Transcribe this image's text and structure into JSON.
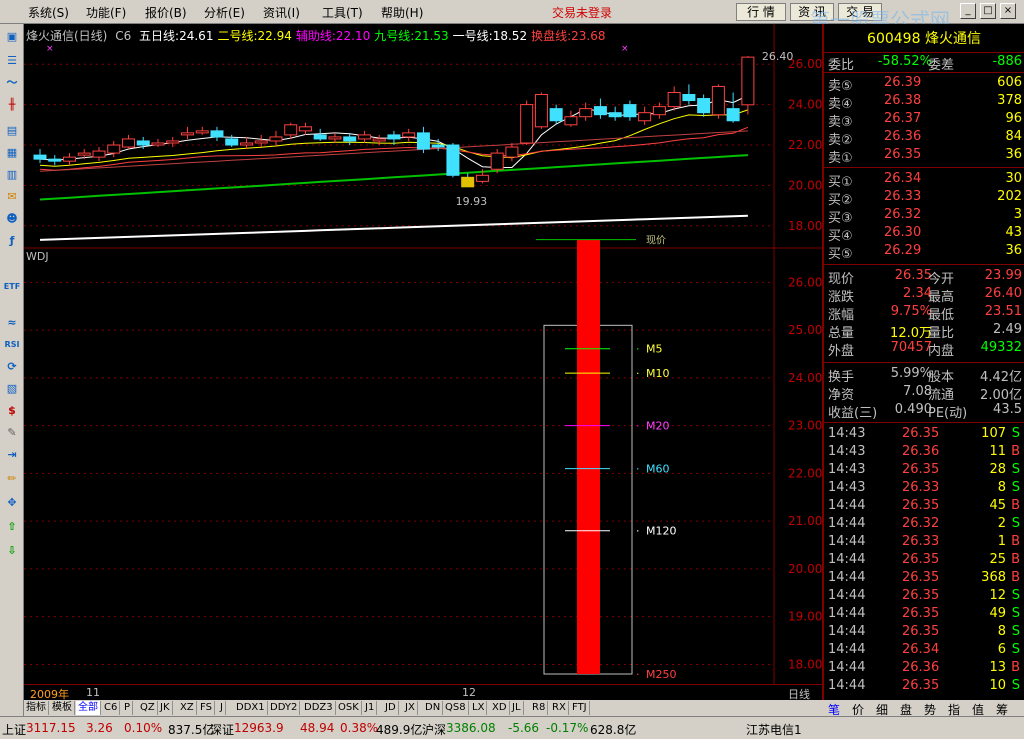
{
  "menu": {
    "items": [
      "系统(S)",
      "功能(F)",
      "报价(B)",
      "分析(E)",
      "资讯(I)",
      "工具(T)",
      "帮助(H)"
    ],
    "login_status": "交易未登录",
    "quote_button": "行 情",
    "info_button": "资 讯",
    "trade_button": "交 易"
  },
  "watermark": "第一股票公式网",
  "chart": {
    "title": "烽火通信(日线)",
    "indicator": "C6",
    "lines": [
      {
        "label": "五日线:",
        "value": "24.61",
        "color": "#ffffff"
      },
      {
        "label": "二号线:",
        "value": "22.94",
        "color": "#ffff00"
      },
      {
        "label": "辅助线:",
        "value": "22.10",
        "color": "#ff00ff"
      },
      {
        "label": "九号线:",
        "value": "21.53",
        "color": "#00ff00"
      },
      {
        "label": "一号线:",
        "value": "18.52",
        "color": "#ffffff"
      },
      {
        "label": "换盘线:",
        "value": "23.68",
        "color": "#ff4040"
      }
    ],
    "high_marker": "26.40",
    "low_marker": "19.93",
    "upper_axis": [
      "26.00",
      "24.00",
      "22.00",
      "20.00",
      "18.00"
    ],
    "lower_title": "WDJ",
    "lower_axis": [
      "26.00",
      "25.00",
      "24.00",
      "23.00",
      "22.00",
      "21.00",
      "20.00",
      "19.00",
      "18.00"
    ],
    "ma_labels": [
      "M5",
      "M10",
      "M20",
      "M60",
      "M120",
      "M250"
    ],
    "top_label": "现价",
    "dates": {
      "year": "2009年",
      "m1": "11",
      "m2": "12",
      "period": "日线"
    }
  },
  "bottom_tabs": [
    "指标",
    "模板",
    "全部",
    "C6",
    "P",
    "QZ",
    "JK",
    "XZ",
    "FS",
    "J",
    "DDX1",
    "DDY2",
    "DDZ3",
    "OSK",
    "J1",
    "JD",
    "JX",
    "DN",
    "QS8",
    "LX",
    "XD",
    "JL",
    "R8",
    "RX",
    "FTJ"
  ],
  "status": {
    "sh_label": "上证",
    "sh_val": "3117.15",
    "sh_chg": "3.26",
    "sh_pct": "0.10%",
    "sh_amt": "837.5亿",
    "sz_label": "深证",
    "sz_val": "12963.9",
    "sz_chg": "48.94",
    "sz_pct": "0.38%",
    "sz_amt": "489.9亿",
    "hs_label": "沪深",
    "hs_val": "3386.08",
    "hs_chg": "-5.66",
    "hs_pct": "-0.17%",
    "hs_amt": "628.8亿",
    "isp": "江苏电信1"
  },
  "quote": {
    "code_name": "600498 烽火通信",
    "ratio_label": "委比",
    "ratio": "-58.52%",
    "diff_label": "委差",
    "diff": "-886",
    "sells": [
      {
        "label": "卖⑤",
        "price": "26.39",
        "vol": "606"
      },
      {
        "label": "卖④",
        "price": "26.38",
        "vol": "378"
      },
      {
        "label": "卖③",
        "price": "26.37",
        "vol": "96"
      },
      {
        "label": "卖②",
        "price": "26.36",
        "vol": "84"
      },
      {
        "label": "卖①",
        "price": "26.35",
        "vol": "36"
      }
    ],
    "buys": [
      {
        "label": "买①",
        "price": "26.34",
        "vol": "30"
      },
      {
        "label": "买②",
        "price": "26.33",
        "vol": "202"
      },
      {
        "label": "买③",
        "price": "26.32",
        "vol": "3"
      },
      {
        "label": "买④",
        "price": "26.30",
        "vol": "43"
      },
      {
        "label": "买⑤",
        "price": "26.29",
        "vol": "36"
      }
    ],
    "stats": [
      {
        "l1": "现价",
        "v1": "26.35",
        "c1": "#ff4040",
        "l2": "今开",
        "v2": "23.99",
        "c2": "#ff4040"
      },
      {
        "l1": "涨跌",
        "v1": "2.34",
        "c1": "#ff4040",
        "l2": "最高",
        "v2": "26.40",
        "c2": "#ff4040"
      },
      {
        "l1": "涨幅",
        "v1": "9.75%",
        "c1": "#ff4040",
        "l2": "最低",
        "v2": "23.51",
        "c2": "#ff4040"
      },
      {
        "l1": "总量",
        "v1": "12.0万",
        "c1": "#ffff00",
        "l2": "量比",
        "v2": "2.49",
        "c2": "#c0c0c0"
      },
      {
        "l1": "外盘",
        "v1": "70457",
        "c1": "#ff4040",
        "l2": "内盘",
        "v2": "49332",
        "c2": "#00ff00"
      }
    ],
    "stats2": [
      {
        "l1": "换手",
        "v1": "5.99%",
        "l2": "股本",
        "v2": "4.42亿"
      },
      {
        "l1": "净资",
        "v1": "7.08",
        "l2": "流通",
        "v2": "2.00亿"
      },
      {
        "l1": "收益(三)",
        "v1": "0.490",
        "l2": "PE(动)",
        "v2": "43.5"
      }
    ],
    "ticks": [
      {
        "t": "14:43",
        "p": "26.35",
        "v": "107",
        "f": "S"
      },
      {
        "t": "14:43",
        "p": "26.36",
        "v": "11",
        "f": "B"
      },
      {
        "t": "14:43",
        "p": "26.35",
        "v": "28",
        "f": "S"
      },
      {
        "t": "14:43",
        "p": "26.33",
        "v": "8",
        "f": "S"
      },
      {
        "t": "14:44",
        "p": "26.35",
        "v": "45",
        "f": "B"
      },
      {
        "t": "14:44",
        "p": "26.32",
        "v": "2",
        "f": "S"
      },
      {
        "t": "14:44",
        "p": "26.33",
        "v": "1",
        "f": "B"
      },
      {
        "t": "14:44",
        "p": "26.35",
        "v": "25",
        "f": "B"
      },
      {
        "t": "14:44",
        "p": "26.35",
        "v": "368",
        "f": "B"
      },
      {
        "t": "14:44",
        "p": "26.35",
        "v": "12",
        "f": "S"
      },
      {
        "t": "14:44",
        "p": "26.35",
        "v": "49",
        "f": "S"
      },
      {
        "t": "14:44",
        "p": "26.35",
        "v": "8",
        "f": "S"
      },
      {
        "t": "14:44",
        "p": "26.34",
        "v": "6",
        "f": "S"
      },
      {
        "t": "14:44",
        "p": "26.36",
        "v": "13",
        "f": "B"
      },
      {
        "t": "14:44",
        "p": "26.35",
        "v": "10",
        "f": "S"
      }
    ],
    "tabs": [
      "笔",
      "价",
      "细",
      "盘",
      "势",
      "指",
      "值",
      "筹"
    ]
  },
  "chart_data": {
    "type": "candlestick",
    "price_levels": {
      "high": 26.4,
      "low": 19.93
    },
    "ma_values": {
      "五日线": 24.61,
      "二号线": 22.94,
      "辅助线": 22.1,
      "九号线": 21.53,
      "一号线": 18.52,
      "换盘线": 23.68
    },
    "candles": [
      [
        21.5,
        21.3,
        21.8,
        21.1
      ],
      [
        21.3,
        21.2,
        21.5,
        21.0
      ],
      [
        21.2,
        21.4,
        21.6,
        21.0
      ],
      [
        21.5,
        21.6,
        21.8,
        21.3
      ],
      [
        21.4,
        21.7,
        21.9,
        21.2
      ],
      [
        21.6,
        22.0,
        22.2,
        21.4
      ],
      [
        21.9,
        22.3,
        22.5,
        21.8
      ],
      [
        22.2,
        22.0,
        22.4,
        21.8
      ],
      [
        22.0,
        22.1,
        22.3,
        21.9
      ],
      [
        22.1,
        22.2,
        22.4,
        21.9
      ],
      [
        22.5,
        22.6,
        22.9,
        22.3
      ],
      [
        22.6,
        22.7,
        22.9,
        22.5
      ],
      [
        22.7,
        22.4,
        22.9,
        22.2
      ],
      [
        22.3,
        22.0,
        22.5,
        21.9
      ],
      [
        22.0,
        22.1,
        22.4,
        21.8
      ],
      [
        22.1,
        22.2,
        22.5,
        21.9
      ],
      [
        22.2,
        22.4,
        22.7,
        22.0
      ],
      [
        22.5,
        23.0,
        23.1,
        22.3
      ],
      [
        22.7,
        22.9,
        23.1,
        22.5
      ],
      [
        22.5,
        22.3,
        22.8,
        22.2
      ],
      [
        22.3,
        22.4,
        22.6,
        22.1
      ],
      [
        22.4,
        22.2,
        22.6,
        22.0
      ],
      [
        22.3,
        22.5,
        22.7,
        22.1
      ],
      [
        22.2,
        22.3,
        22.5,
        22.0
      ],
      [
        22.5,
        22.3,
        22.7,
        22.0
      ],
      [
        22.4,
        22.6,
        22.8,
        22.2
      ],
      [
        22.6,
        21.8,
        22.9,
        21.6
      ],
      [
        22.0,
        21.9,
        22.3,
        21.7
      ],
      [
        22.0,
        20.5,
        22.1,
        20.4
      ],
      [
        20.4,
        19.93,
        20.6,
        19.93
      ],
      [
        20.2,
        20.5,
        20.8,
        20.1
      ],
      [
        20.8,
        21.6,
        21.8,
        20.6
      ],
      [
        21.4,
        21.9,
        22.1,
        21.2
      ],
      [
        22.1,
        24.0,
        24.2,
        22.0
      ],
      [
        22.9,
        24.5,
        24.6,
        22.8
      ],
      [
        23.8,
        23.2,
        24.0,
        23.0
      ],
      [
        23.0,
        23.4,
        23.7,
        22.9
      ],
      [
        23.4,
        23.8,
        24.1,
        23.2
      ],
      [
        23.9,
        23.5,
        24.3,
        23.3
      ],
      [
        23.6,
        23.4,
        23.9,
        23.2
      ],
      [
        24.0,
        23.4,
        24.2,
        23.2
      ],
      [
        23.2,
        23.6,
        23.9,
        23.0
      ],
      [
        23.5,
        23.9,
        24.1,
        23.3
      ],
      [
        23.9,
        24.6,
        24.9,
        23.7
      ],
      [
        24.5,
        24.2,
        25.0,
        24.0
      ],
      [
        24.3,
        23.6,
        24.5,
        23.4
      ],
      [
        23.5,
        24.9,
        25.0,
        23.3
      ],
      [
        23.8,
        23.2,
        24.6,
        23.1
      ],
      [
        23.99,
        26.35,
        26.4,
        23.51
      ]
    ],
    "wdj_close": 26.35,
    "wdj_ma": {
      "M5": 24.61,
      "M10": 24.1,
      "M20": 23.0,
      "M60": 22.1,
      "M120": 20.8,
      "M250": 17.8
    },
    "ylim_upper": [
      17.0,
      27.0
    ],
    "ylim_lower": [
      17.8,
      26.3
    ]
  }
}
